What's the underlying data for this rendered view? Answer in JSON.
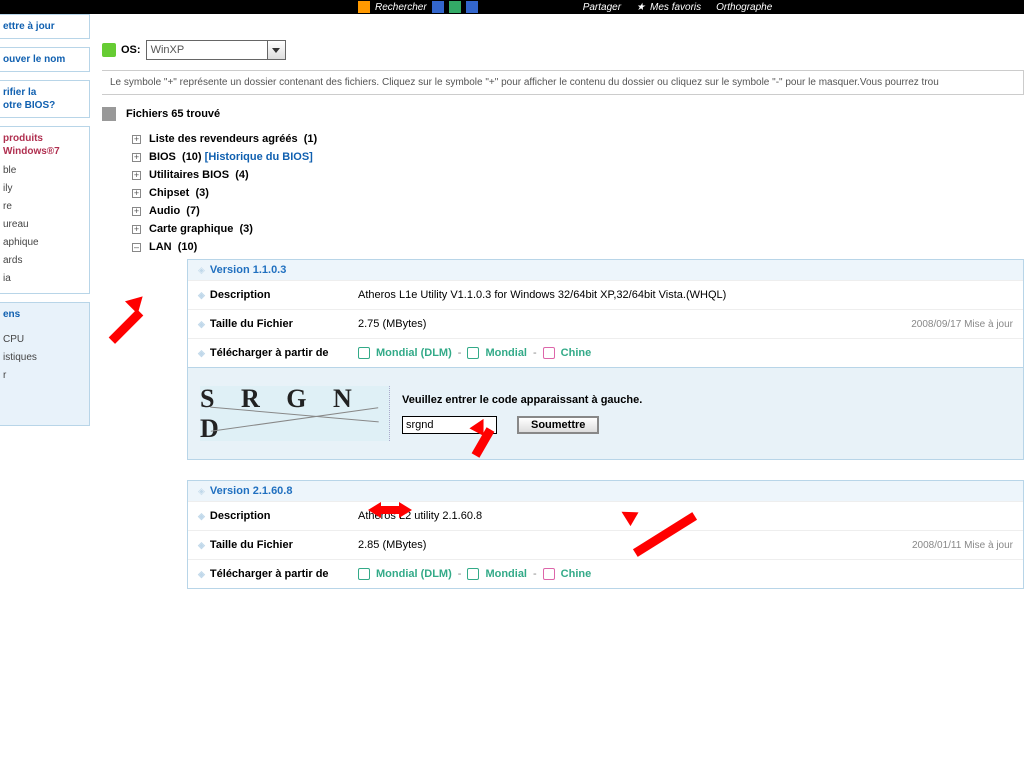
{
  "toolbar": {
    "search": "Rechercher",
    "share": "Partager",
    "favs": "Mes favoris",
    "spell": "Orthographe"
  },
  "sidebar": {
    "panel1": "ettre à jour",
    "panel2": "ouver le nom",
    "panel3a": "rifier la",
    "panel3b": "otre BIOS?",
    "red1": "produits",
    "red2": "Windows®7",
    "items": [
      "ble",
      "ily",
      "re",
      "ureau",
      "aphique",
      "ards",
      "ia"
    ],
    "panel3_items": [
      "ens",
      "CPU",
      "istiques",
      "r"
    ]
  },
  "os": {
    "label": "OS:",
    "value": "WinXP"
  },
  "hint": "Le symbole \"+\" représente un dossier contenant des fichiers. Cliquez sur le symbole \"+\" pour afficher le contenu du dossier ou cliquez sur le symbole \"-\" pour le masquer.Vous pourrez trou",
  "files_header": "Fichiers 65 trouvé",
  "tree": [
    {
      "label": "Liste des revendeurs agréés",
      "count": "(1)",
      "expanded": false
    },
    {
      "label": "BIOS",
      "count": "(10)",
      "extra": "[Historique du BIOS]",
      "expanded": false
    },
    {
      "label": "Utilitaires BIOS",
      "count": "(4)",
      "expanded": false
    },
    {
      "label": "Chipset",
      "count": "(3)",
      "expanded": false
    },
    {
      "label": "Audio",
      "count": "(7)",
      "expanded": false
    },
    {
      "label": "Carte graphique",
      "count": "(3)",
      "expanded": false
    },
    {
      "label": "LAN",
      "count": "(10)",
      "expanded": true
    }
  ],
  "labels": {
    "description": "Description",
    "filesize": "Taille du Fichier",
    "download_from": "Télécharger à partir de",
    "update_suffix": "Mise à jour",
    "mondial_dlm": "Mondial (DLM)",
    "mondial": "Mondial",
    "chine": "Chine"
  },
  "v1": {
    "version": "Version 1.1.0.3",
    "desc": "Atheros L1e Utility V1.1.0.3 for Windows 32/64bit XP,32/64bit Vista.(WHQL)",
    "size": "2.75 (MBytes)",
    "date": "2008/09/17"
  },
  "captcha": {
    "image_text": "S R G N D",
    "prompt": "Veuillez entrer le code apparaissant à gauche.",
    "value": "srgnd",
    "button": "Soumettre"
  },
  "v2": {
    "version": "Version 2.1.60.8",
    "desc": "Atheros L2 utility 2.1.60.8",
    "size": "2.85 (MBytes)",
    "date": "2008/01/11"
  }
}
